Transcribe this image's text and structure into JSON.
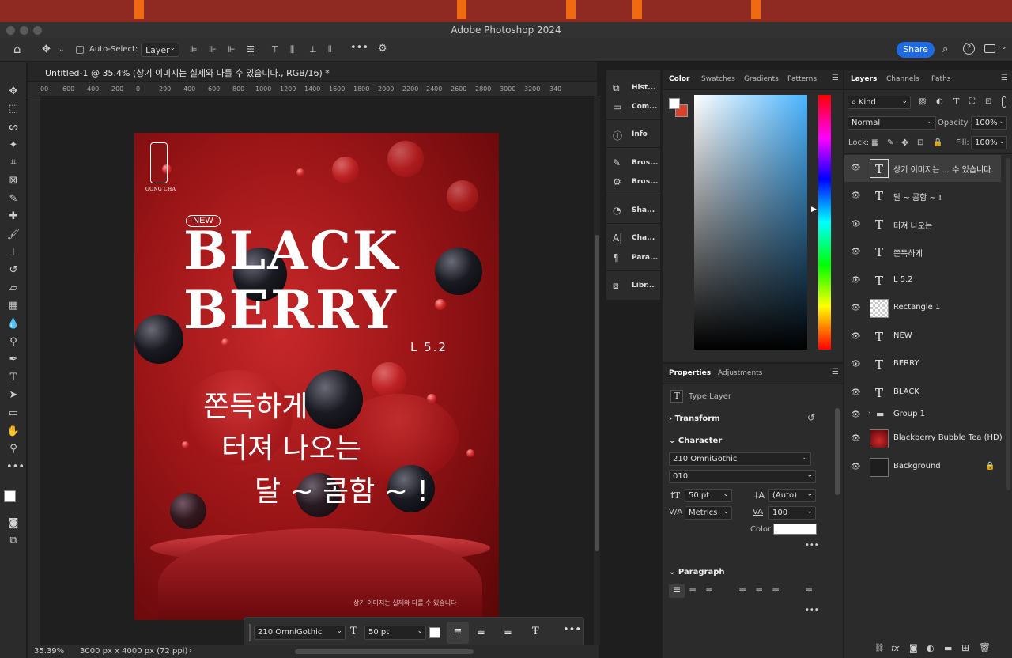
{
  "app": {
    "window_title": "Adobe Photoshop 2024"
  },
  "options_bar": {
    "auto_select_label": "Auto-Select:",
    "auto_select_value": "Layer",
    "share_label": "Share"
  },
  "document": {
    "tab_title": "Untitled-1 @ 35.4% (상기 이미지는 실제와 다를 수 있습니다., RGB/16) *",
    "zoom": "35.39%",
    "size_info": "3000 px x 4000 px (72 ppi)",
    "ruler_labels": [
      "00",
      "600",
      "400",
      "200",
      "0",
      "200",
      "400",
      "600",
      "800",
      "1000",
      "1200",
      "1400",
      "1600",
      "1800",
      "2000",
      "2200",
      "2400",
      "2600",
      "2800",
      "3000",
      "3200",
      "340"
    ]
  },
  "poster": {
    "brand": "GONG CHA",
    "new_badge": "NEW",
    "line1": "BLACK",
    "line2": "BERRY",
    "price": "L 5.2",
    "kor1": "쫀득하게",
    "kor2": "터져 나오는",
    "kor3": "달 ~ 콤함 ~ !",
    "disclaimer": "상기 이미지는 실제와 다를 수 있습니다"
  },
  "text_toolbar": {
    "font": "210 OmniGothic",
    "size": "50 pt"
  },
  "mini_panel": {
    "items": [
      "Hist...",
      "Com...",
      "Info",
      "Brus...",
      "Brus...",
      "Sha...",
      "Cha...",
      "Para...",
      "Libr..."
    ]
  },
  "color_panel": {
    "tabs": [
      "Color",
      "Swatches",
      "Gradients",
      "Patterns"
    ],
    "foreground": "#ffffff",
    "background": "#d9412b"
  },
  "properties_panel": {
    "tabs": [
      "Properties",
      "Adjustments"
    ],
    "type_label": "Type Layer",
    "transform": "Transform",
    "character": "Character",
    "font_family": "210 OmniGothic",
    "font_style": "010",
    "font_size": "50 pt",
    "leading": "(Auto)",
    "kerning": "Metrics",
    "tracking": "100",
    "color_label": "Color",
    "paragraph": "Paragraph"
  },
  "layers_panel": {
    "tabs": [
      "Layers",
      "Channels",
      "Paths"
    ],
    "filter": "Kind",
    "blend_mode": "Normal",
    "opacity_label": "Opacity:",
    "opacity": "100%",
    "lock_label": "Lock:",
    "fill_label": "Fill:",
    "fill": "100%",
    "layers": [
      {
        "name": "상기 이미지는 ... 수 있습니다.",
        "kind": "type",
        "selected": true
      },
      {
        "name": "달 ~ 콤함 ~ !",
        "kind": "type"
      },
      {
        "name": "터져 나오는",
        "kind": "type"
      },
      {
        "name": "쫀득하게",
        "kind": "type"
      },
      {
        "name": "L 5.2",
        "kind": "type"
      },
      {
        "name": "Rectangle 1",
        "kind": "shape"
      },
      {
        "name": "NEW",
        "kind": "type"
      },
      {
        "name": "BERRY",
        "kind": "type"
      },
      {
        "name": "BLACK",
        "kind": "type"
      },
      {
        "name": "Group 1",
        "kind": "group"
      },
      {
        "name": "Blackberry Bubble Tea (HD)",
        "kind": "image"
      },
      {
        "name": "Background",
        "kind": "background"
      }
    ]
  }
}
